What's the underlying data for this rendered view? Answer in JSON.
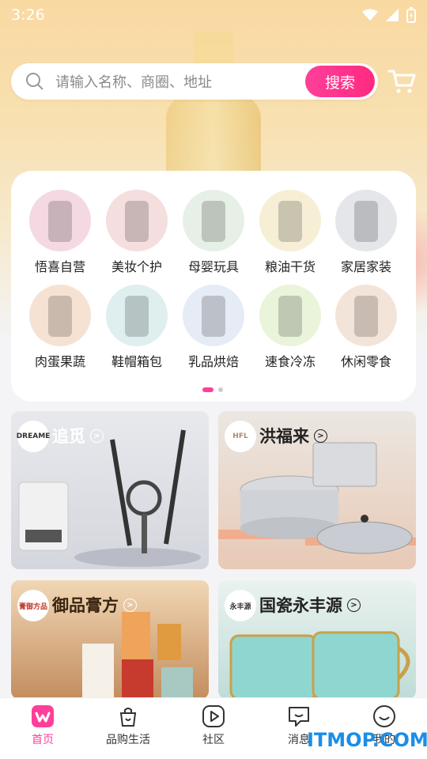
{
  "status_bar": {
    "time": "3:26"
  },
  "search": {
    "placeholder": "请输入名称、商圈、地址",
    "button_label": "搜索"
  },
  "categories": [
    {
      "label": "悟喜自营",
      "icon": "skincare-bottle-icon",
      "color": "#f4d9e2"
    },
    {
      "label": "美妆个护",
      "icon": "cosmetics-icon",
      "color": "#f4dede"
    },
    {
      "label": "母婴玩具",
      "icon": "baby-bottle-icon",
      "color": "#e6f0e6"
    },
    {
      "label": "粮油干货",
      "icon": "cooking-oil-icon",
      "color": "#f6efd6"
    },
    {
      "label": "家居家装",
      "icon": "bedding-icon",
      "color": "#e4e6ea"
    },
    {
      "label": "肉蛋果蔬",
      "icon": "meat-icon",
      "color": "#f6e2d2"
    },
    {
      "label": "鞋帽箱包",
      "icon": "luggage-icon",
      "color": "#dfeeee"
    },
    {
      "label": "乳品烘焙",
      "icon": "milk-powder-icon",
      "color": "#e6ecf6"
    },
    {
      "label": "速食冷冻",
      "icon": "corn-icon",
      "color": "#eaf4da"
    },
    {
      "label": "休闲零食",
      "icon": "nuts-icon",
      "color": "#f3e4da"
    }
  ],
  "brands": [
    {
      "name": "追觅",
      "logo_text": "DREAME",
      "bg": "#e7e8ec"
    },
    {
      "name": "洪福来",
      "logo_text": "HFL",
      "bg": "#e9e5e0"
    },
    {
      "name": "御品膏方",
      "logo_text": "膏御方品",
      "bg": "#c89a6a"
    },
    {
      "name": "国瓷永丰源",
      "logo_text": "永丰源",
      "bg": "#cfe6e4"
    }
  ],
  "tabs": [
    {
      "label": "首页",
      "active": true
    },
    {
      "label": "品购生活",
      "active": false
    },
    {
      "label": "社区",
      "active": false
    },
    {
      "label": "消息",
      "active": false
    },
    {
      "label": "我的",
      "active": false
    }
  ],
  "watermark": "ITMOP.COM",
  "colors": {
    "accent": "#ff3f9a",
    "page_bg": "#f4f4f6"
  }
}
